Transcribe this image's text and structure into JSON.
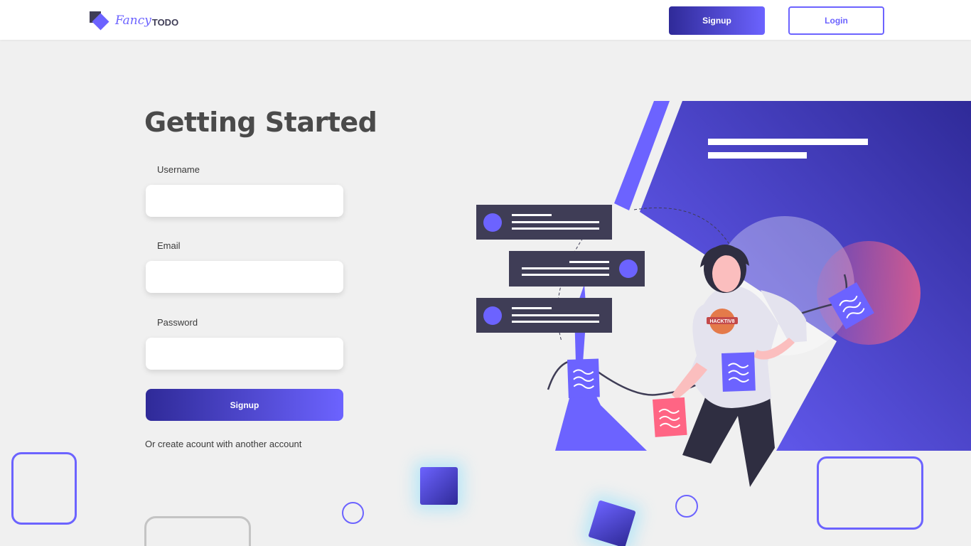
{
  "navbar": {
    "logo": {
      "fancy": "Fancy",
      "todo": "TODO"
    },
    "signup_label": "Signup",
    "login_label": "Login"
  },
  "form": {
    "title": "Getting Started",
    "username_label": "Username",
    "email_label": "Email",
    "password_label": "Password",
    "submit_label": "Signup",
    "alt_text": "Or create acount with another account"
  },
  "illustration": {
    "shirt_logo": "HACKTIV8"
  },
  "colors": {
    "accent": "#6c63ff",
    "accent_dark": "#2f2a98",
    "text_dark": "#3f3d56",
    "pink": "#ff6584"
  }
}
